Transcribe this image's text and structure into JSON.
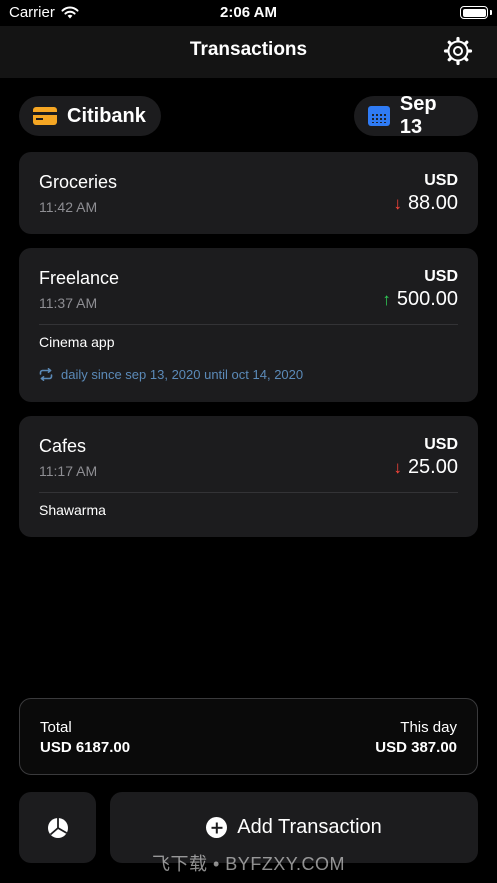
{
  "status_bar": {
    "carrier": "Carrier",
    "time": "2:06 AM"
  },
  "nav": {
    "title": "Transactions"
  },
  "filters": {
    "account": "Citibank",
    "date": "Sep 13"
  },
  "transactions": [
    {
      "name": "Groceries",
      "time": "11:42 AM",
      "currency": "USD",
      "amount": "88.00",
      "direction": "down"
    },
    {
      "name": "Freelance",
      "time": "11:37 AM",
      "currency": "USD",
      "amount": "500.00",
      "direction": "up",
      "note": "Cinema app",
      "recurrence": "daily since sep 13, 2020 until oct 14, 2020"
    },
    {
      "name": "Cafes",
      "time": "11:17 AM",
      "currency": "USD",
      "amount": "25.00",
      "direction": "down",
      "note": "Shawarma"
    }
  ],
  "arrows": {
    "down": "↓",
    "up": "↑"
  },
  "summary": {
    "total_label": "Total",
    "total_value": "USD 6187.00",
    "day_label": "This day",
    "day_value": "USD 387.00"
  },
  "actions": {
    "add_label": "Add Transaction"
  },
  "watermark": "飞下载 • BYFZXY.COM",
  "colors": {
    "background": "#000000",
    "card": "#1c1c1e",
    "expense": "#ff453a",
    "income": "#30d158",
    "recurrence": "#5b8ab8",
    "account_icon": "#f5a623",
    "date_icon": "#2f7bf5"
  }
}
